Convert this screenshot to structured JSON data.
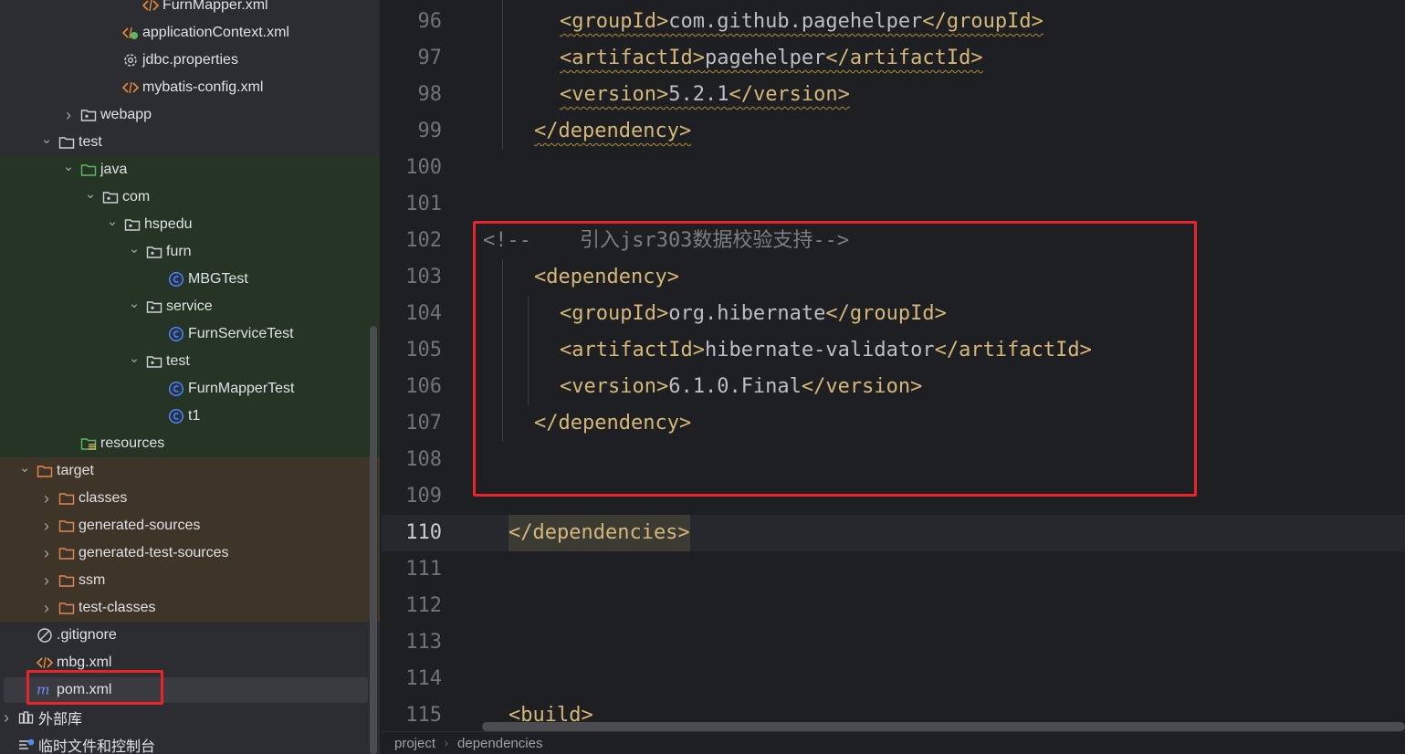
{
  "tree": {
    "items": [
      {
        "label": "FurnMapper.xml",
        "icon": "xml-icon",
        "chevron": "none",
        "bg": "dark"
      },
      {
        "label": "applicationContext.xml",
        "icon": "spring-xml-icon",
        "chevron": "none",
        "bg": "dark"
      },
      {
        "label": "jdbc.properties",
        "icon": "gear-icon",
        "chevron": "none",
        "bg": "dark"
      },
      {
        "label": "mybatis-config.xml",
        "icon": "xml-icon",
        "chevron": "none",
        "bg": "dark"
      },
      {
        "label": "webapp",
        "icon": "package-folder-icon",
        "chevron": "collapsed",
        "bg": "dark"
      },
      {
        "label": "test",
        "icon": "folder-icon",
        "chevron": "expanded",
        "bg": "dark"
      },
      {
        "label": "java",
        "icon": "green-folder-icon",
        "chevron": "expanded",
        "bg": "green"
      },
      {
        "label": "com",
        "icon": "package-folder-icon",
        "chevron": "expanded",
        "bg": "green"
      },
      {
        "label": "hspedu",
        "icon": "package-folder-icon",
        "chevron": "expanded",
        "bg": "green"
      },
      {
        "label": "furn",
        "icon": "package-folder-icon",
        "chevron": "expanded",
        "bg": "green"
      },
      {
        "label": "MBGTest",
        "icon": "class-icon",
        "chevron": "none",
        "bg": "green"
      },
      {
        "label": "service",
        "icon": "package-folder-icon",
        "chevron": "expanded",
        "bg": "green"
      },
      {
        "label": "FurnServiceTest",
        "icon": "class-icon",
        "chevron": "none",
        "bg": "green"
      },
      {
        "label": "test",
        "icon": "package-folder-icon",
        "chevron": "expanded",
        "bg": "green"
      },
      {
        "label": "FurnMapperTest",
        "icon": "class-icon",
        "chevron": "none",
        "bg": "green"
      },
      {
        "label": "t1",
        "icon": "class-icon",
        "chevron": "none",
        "bg": "green"
      },
      {
        "label": "resources",
        "icon": "resources-folder-icon",
        "chevron": "none",
        "bg": "green"
      },
      {
        "label": "target",
        "icon": "orange-folder-icon",
        "chevron": "expanded",
        "bg": "brown"
      },
      {
        "label": "classes",
        "icon": "orange-folder-icon",
        "chevron": "collapsed",
        "bg": "brown"
      },
      {
        "label": "generated-sources",
        "icon": "orange-folder-icon",
        "chevron": "collapsed",
        "bg": "brown"
      },
      {
        "label": "generated-test-sources",
        "icon": "orange-folder-icon",
        "chevron": "collapsed",
        "bg": "brown"
      },
      {
        "label": "ssm",
        "icon": "orange-folder-icon",
        "chevron": "collapsed",
        "bg": "brown"
      },
      {
        "label": "test-classes",
        "icon": "orange-folder-icon",
        "chevron": "collapsed",
        "bg": "brown"
      },
      {
        "label": ".gitignore",
        "icon": "ignore-icon",
        "chevron": "none",
        "bg": "dark"
      },
      {
        "label": "mbg.xml",
        "icon": "xml-icon",
        "chevron": "none",
        "bg": "dark"
      },
      {
        "label": "pom.xml",
        "icon": "maven-icon",
        "chevron": "none",
        "bg": "selected"
      },
      {
        "label": "外部库",
        "icon": "library-icon",
        "chevron": "collapsed",
        "bg": "dark"
      },
      {
        "label": "临时文件和控制台",
        "icon": "scratches-icon",
        "chevron": "none",
        "bg": "dark"
      }
    ]
  },
  "editor": {
    "line_numbers": [
      "96",
      "97",
      "98",
      "99",
      "100",
      "101",
      "102",
      "103",
      "104",
      "105",
      "106",
      "107",
      "108",
      "109",
      "110",
      "111",
      "112",
      "113",
      "114",
      "115"
    ],
    "current_line": "110",
    "lines": {
      "l96": {
        "open": "<groupId>",
        "text": "com.github.pagehelper",
        "close": "</groupId>"
      },
      "l97": {
        "open": "<artifactId>",
        "text": "pagehelper",
        "close": "</artifactId>"
      },
      "l98": {
        "open": "<version>",
        "text": "5.2.1",
        "close": "</version>"
      },
      "l99": {
        "close": "</dependency>"
      },
      "l102": {
        "comment": "<!--    引入jsr303数据校验支持-->"
      },
      "l103": {
        "open": "<dependency>"
      },
      "l104": {
        "open": "<groupId>",
        "text": "org.hibernate",
        "close": "</groupId>"
      },
      "l105": {
        "open": "<artifactId>",
        "text": "hibernate-validator",
        "close": "</artifactId>"
      },
      "l106": {
        "open": "<version>",
        "text": "6.1.0.Final",
        "close": "</version>"
      },
      "l107": {
        "close": "</dependency>"
      },
      "l110": {
        "close": "</dependencies>"
      },
      "l115": {
        "open": "<build>"
      }
    }
  },
  "breadcrumb": {
    "items": [
      "project",
      "dependencies"
    ]
  },
  "colors": {
    "highlight": "#e8232a",
    "tag": "#d5b778",
    "text": "#bcbec4",
    "comment": "#7a7e85"
  }
}
